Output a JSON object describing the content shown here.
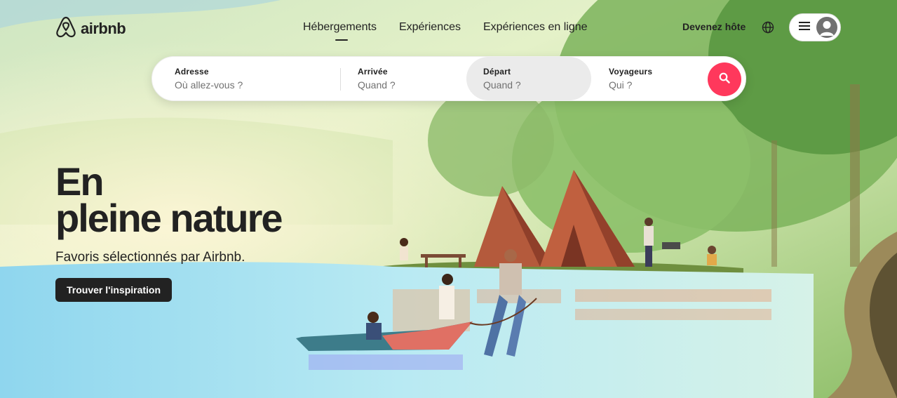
{
  "brand": {
    "name": "airbnb",
    "logo_icon": "airbnb-logo-icon"
  },
  "nav": {
    "items": [
      {
        "label": "Hébergements",
        "active": true
      },
      {
        "label": "Expériences",
        "active": false
      },
      {
        "label": "Expériences en ligne",
        "active": false
      }
    ]
  },
  "header_right": {
    "host_label": "Devenez hôte",
    "globe_icon": "globe-icon",
    "menu_icon": "menu-icon",
    "avatar_icon": "user-avatar-icon"
  },
  "search": {
    "address": {
      "label": "Adresse",
      "placeholder": "Où allez-vous ?"
    },
    "arrival": {
      "label": "Arrivée",
      "placeholder": "Quand ?"
    },
    "departure": {
      "label": "Départ",
      "placeholder": "Quand ?"
    },
    "guests": {
      "label": "Voyageurs",
      "placeholder": "Qui ?"
    },
    "button_icon": "search-icon",
    "accent_color": "#ff385c"
  },
  "hero": {
    "title_line1": "En",
    "title_line2": "pleine nature",
    "subtitle": "Favoris sélectionnés par Airbnb.",
    "cta_label": "Trouver l'inspiration"
  }
}
